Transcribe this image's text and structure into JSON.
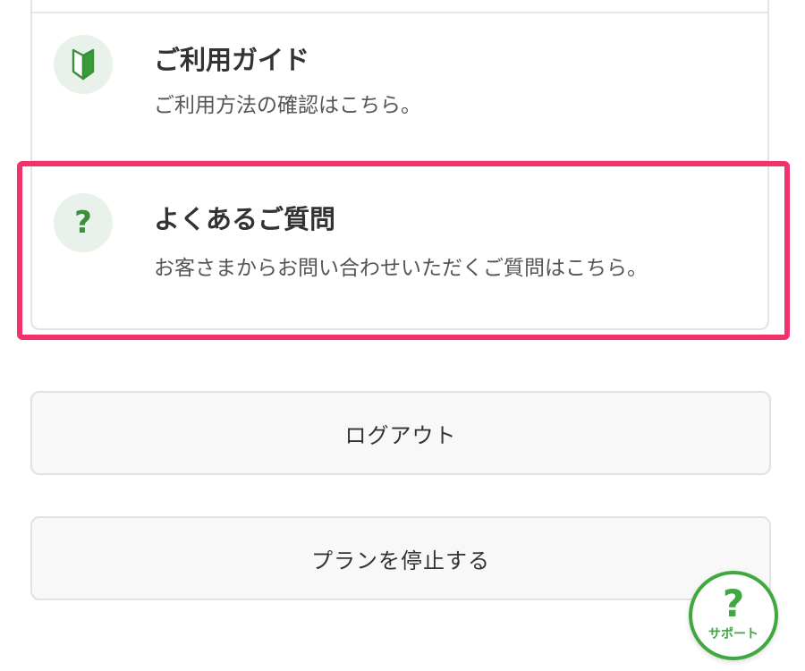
{
  "menu": {
    "guide": {
      "icon": "beginner-leaf-icon",
      "title": "ご利用ガイド",
      "description": "ご利用方法の確認はこちら。"
    },
    "faq": {
      "icon": "question-icon",
      "icon_glyph": "?",
      "title": "よくあるご質問",
      "description": "お客さまからお問い合わせいただくご質問はこちら。"
    }
  },
  "buttons": {
    "logout_label": "ログアウト",
    "stop_plan_label": "プランを停止する"
  },
  "support": {
    "icon": "question-icon",
    "glyph": "?",
    "label": "サポート"
  },
  "colors": {
    "accent_green": "#3fa83f",
    "highlight_pink": "#f2336b",
    "icon_bg": "#e8f2ea"
  }
}
